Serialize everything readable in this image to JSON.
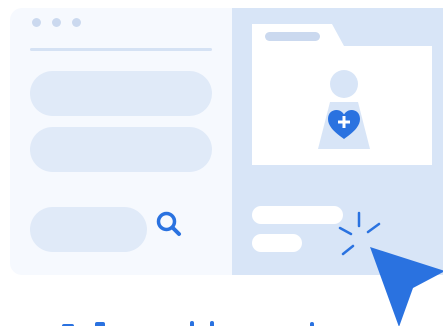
{
  "illustration": {
    "window_dots": [
      "dot",
      "dot",
      "dot"
    ],
    "fields": [
      "field",
      "field"
    ],
    "icons": {
      "search": "search-icon",
      "folder": "folder-icon",
      "person": "person-icon",
      "heart": "heart-plus-icon",
      "sparkle": "click-burst-icon",
      "cursor": "cursor-arrow-icon"
    },
    "colors": {
      "accent": "#2a72e0",
      "card_left": "#f6f9fe",
      "card_right": "#d8e5f7",
      "placeholder": "#e0eaf8",
      "white": "#ffffff"
    }
  }
}
